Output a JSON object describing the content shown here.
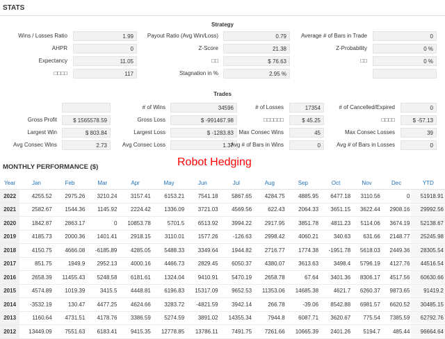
{
  "header": {
    "title": "STATS"
  },
  "strategy": {
    "title": "Strategy",
    "items": [
      {
        "label": "Wins / Losses Ratio",
        "value": "1.99"
      },
      {
        "label": "Payout Ratio (Avg Win/Loss)",
        "value": "0.79"
      },
      {
        "label": "Average # of Bars in Trade",
        "value": "0"
      },
      {
        "label": "AHPR",
        "value": "0"
      },
      {
        "label": "Z-Score",
        "value": "21.38"
      },
      {
        "label": "Z-Probability",
        "value": "0 %"
      },
      {
        "label": "Expectancy",
        "value": "11.05"
      },
      {
        "label": "□□",
        "value": "$ 76.63"
      },
      {
        "label": "□□",
        "value": "0 %"
      },
      {
        "label": "□□□□",
        "value": "117"
      },
      {
        "label": "Stagnation in %",
        "value": "2.95 %"
      },
      {
        "label": "",
        "value": ""
      }
    ]
  },
  "trades": {
    "title": "Trades",
    "items": [
      {
        "label": "",
        "value": ""
      },
      {
        "label": "# of Wins",
        "value": "34596"
      },
      {
        "label": "# of Losses",
        "value": "17354"
      },
      {
        "label": "# of Cancelled/Expired",
        "value": "0"
      },
      {
        "label": "Gross Profit",
        "value": "$ 1565578.59"
      },
      {
        "label": "Gross Loss",
        "value": "$ -991467.98"
      },
      {
        "label": "□□□□□□",
        "value": "$ 45.25"
      },
      {
        "label": "□□□□",
        "value": "$ -57.13"
      },
      {
        "label": "Largest Win",
        "value": "$ 803.84"
      },
      {
        "label": "Largest Loss",
        "value": "$ -1283.83"
      },
      {
        "label": "Max Consec Wins",
        "value": "45"
      },
      {
        "label": "Max Consec Losses",
        "value": "39"
      },
      {
        "label": "Avg Consec Wins",
        "value": "2.73"
      },
      {
        "label": "Avg Consec Loss",
        "value": "1.37"
      },
      {
        "label": "Avg # of Bars in Wins",
        "value": "0"
      },
      {
        "label": "Avg # of Bars in Losses",
        "value": "0"
      }
    ]
  },
  "monthly": {
    "title": "MONTHLY PERFORMANCE ($)",
    "overlay": "Robot Hedging",
    "columns": [
      "Year",
      "Jan",
      "Feb",
      "Mar",
      "Apr",
      "May",
      "Jun",
      "Jul",
      "Aug",
      "Sep",
      "Oct",
      "Nov",
      "Dec",
      "YTD"
    ],
    "rows": [
      [
        "2022",
        "4255.52",
        "2975.26",
        "3210.24",
        "3157.41",
        "6153.21",
        "7541.18",
        "5867.65",
        "4284.75",
        "4885.95",
        "6477.18",
        "3110.56",
        "0",
        "51918.91"
      ],
      [
        "2021",
        "2582.67",
        "1544.36",
        "1145.92",
        "2224.42",
        "1336.09",
        "3721.03",
        "4569.56",
        "622.43",
        "2064.33",
        "3651.15",
        "3622.44",
        "2908.16",
        "29992.56"
      ],
      [
        "2020",
        "1842.87",
        "2863.17",
        "0",
        "10853.78",
        "5701.5",
        "6513.92",
        "3994.22",
        "2917.95",
        "3851.78",
        "4811.23",
        "5114.06",
        "3674.19",
        "52138.67"
      ],
      [
        "2019",
        "4185.73",
        "2000.36",
        "1401.41",
        "2918.15",
        "3110.01",
        "1577.26",
        "-126.63",
        "2998.42",
        "4060.21",
        "340.63",
        "631.66",
        "2148.77",
        "25245.98"
      ],
      [
        "2018",
        "4150.75",
        "4666.08",
        "-6185.89",
        "4285.05",
        "5488.33",
        "3349.64",
        "1944.82",
        "2716.77",
        "1774.38",
        "-1951.78",
        "5618.03",
        "2449.36",
        "28305.54"
      ],
      [
        "2017",
        "851.75",
        "1949.9",
        "2952.13",
        "4000.16",
        "4466.73",
        "2829.45",
        "6050.37",
        "4380.07",
        "3613.63",
        "3498.4",
        "5796.19",
        "4127.76",
        "44516.54"
      ],
      [
        "2016",
        "2658.39",
        "11455.43",
        "5248.58",
        "6181.61",
        "1324.04",
        "9410.91",
        "5470.19",
        "2658.78",
        "67.64",
        "3401.36",
        "8306.17",
        "4517.56",
        "60630.66"
      ],
      [
        "2015",
        "4574.89",
        "1019.39",
        "3415.5",
        "4448.81",
        "6196.83",
        "15317.09",
        "9652.53",
        "11353.06",
        "14685.38",
        "4621.7",
        "6260.37",
        "9873.65",
        "91419.2"
      ],
      [
        "2014",
        "-3532.19",
        "130.47",
        "4477.25",
        "4624.66",
        "3283.72",
        "-4821.59",
        "3942.14",
        "266.78",
        "-39.06",
        "8542.88",
        "6981.57",
        "6620.52",
        "30485.15"
      ],
      [
        "2013",
        "1160.64",
        "4731.51",
        "4178.76",
        "3386.59",
        "5274.59",
        "3891.02",
        "14355.34",
        "7944.8",
        "6087.71",
        "3620.67",
        "775.54",
        "7385.59",
        "62792.76"
      ],
      [
        "2012",
        "13449.09",
        "7551.63",
        "6183.41",
        "9415.35",
        "12778.85",
        "13786.11",
        "7491.75",
        "7261.66",
        "10665.39",
        "2401.26",
        "5194.7",
        "485.44",
        "96664.64"
      ]
    ]
  },
  "colors": {
    "header_blue": "#1f6fb5",
    "negative": "#d9534f",
    "overlay": "#ff0000"
  }
}
